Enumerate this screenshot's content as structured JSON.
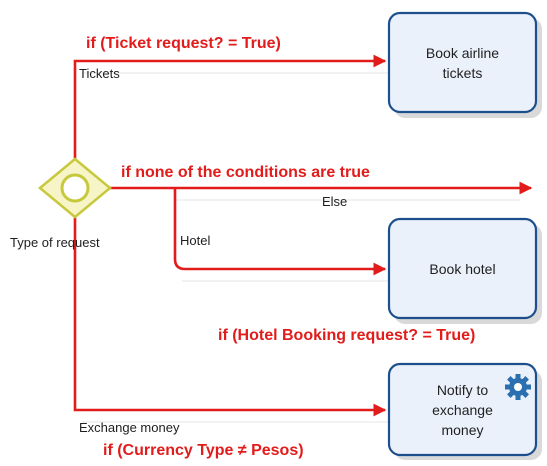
{
  "conditions": {
    "ticket": "if (Ticket request? = True)",
    "none": "if none of the conditions are true",
    "hotel": "if (Hotel Booking request? = True)",
    "currency": "if (Currency Type ≠ Pesos)"
  },
  "flows": {
    "tickets": "Tickets",
    "else": "Else",
    "hotel": "Hotel",
    "exchange": "Exchange money"
  },
  "gateway": {
    "label": "Type of request"
  },
  "tasks": {
    "airline": "Book airline\ntickets",
    "hotel": "Book hotel",
    "notify": "Notify to\nexchange\nmoney"
  },
  "colors": {
    "flow": "#e21b1b",
    "task_border": "#1d4f8c",
    "task_fill": "#eaf1fb",
    "gateway": "#c8c83c",
    "gear": "#2a6fb0"
  },
  "icons": {
    "gateway": "inclusive-gateway-icon",
    "service": "gear-icon"
  }
}
